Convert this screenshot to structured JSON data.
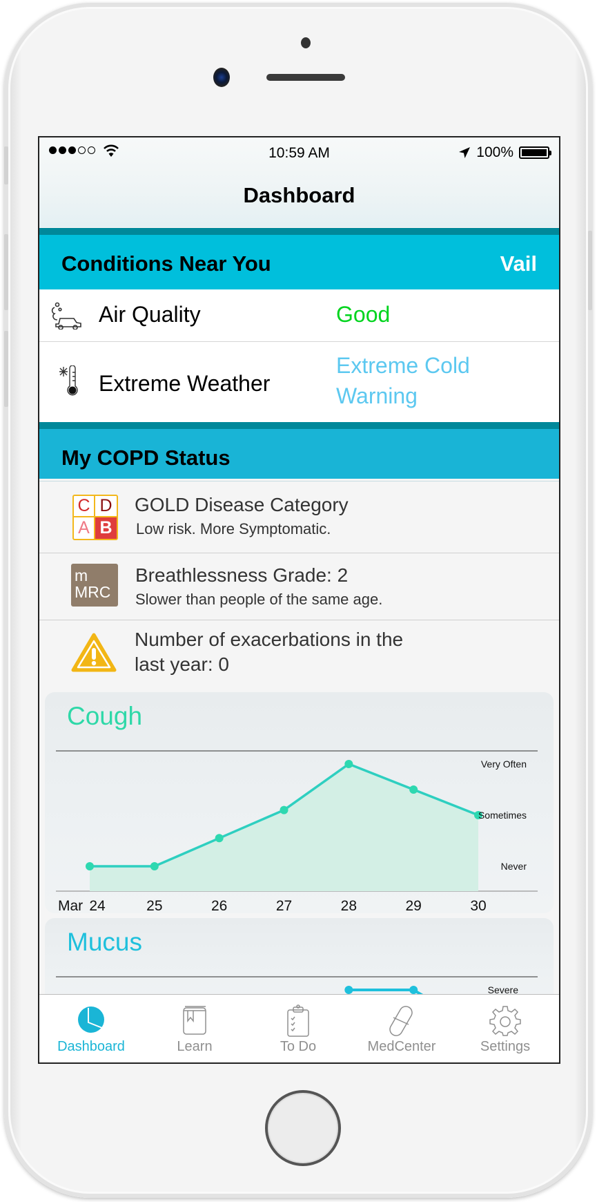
{
  "status_bar": {
    "signal_filled": 3,
    "signal_total": 5,
    "time": "10:59 AM",
    "battery_percent": "100%",
    "icons": [
      "signal-dots-icon",
      "wifi-icon",
      "location-arrow-icon",
      "battery-icon"
    ]
  },
  "nav": {
    "title": "Dashboard"
  },
  "conditions": {
    "header": "Conditions Near You",
    "location": "Vail",
    "rows": [
      {
        "icon": "air-pollution-car-icon",
        "label": "Air Quality",
        "value": "Good",
        "value_color": "#00d41e"
      },
      {
        "icon": "cold-thermometer-icon",
        "label": "Extreme Weather",
        "value_line1": "Extreme Cold",
        "value_line2": "Warning",
        "value_color": "#5cc8f0"
      }
    ]
  },
  "copd": {
    "header": "My COPD Status",
    "items": [
      {
        "icon": "gold-category-grid-icon",
        "grid": [
          "C",
          "D",
          "A",
          "B"
        ],
        "selected": "B",
        "title": "GOLD Disease Category",
        "subtitle": "Low risk. More Symptomatic."
      },
      {
        "icon": "mmrc-icon",
        "badge_line1": "m",
        "badge_line2": "MRC",
        "title": "Breathlessness Grade: 2",
        "subtitle": "Slower than people of the same age."
      },
      {
        "icon": "warning-triangle-icon",
        "title_line1": "Number of exacerbations in the",
        "title_line2": "last year: 0"
      }
    ]
  },
  "chart_data": [
    {
      "type": "area",
      "title": "Cough",
      "title_color": "#2ed8a8",
      "line_color": "#2ecfc0",
      "fill_color": "#d3efe5",
      "x_month_label": "Mar",
      "categories": [
        "24",
        "25",
        "26",
        "27",
        "28",
        "29",
        "30"
      ],
      "values": [
        0,
        0,
        0.55,
        1.1,
        2,
        1.5,
        1
      ],
      "y_ticks": [
        {
          "value": 2,
          "label": "Very Often"
        },
        {
          "value": 1,
          "label": "Sometimes"
        },
        {
          "value": 0,
          "label": "Never"
        }
      ],
      "ylim": [
        0,
        2
      ],
      "xlabel": "",
      "ylabel": "",
      "grid": false
    },
    {
      "type": "area",
      "title": "Mucus",
      "title_color": "#1ec0dc",
      "line_color": "#1ec0dc",
      "partial": true,
      "y_ticks": [
        {
          "value": 2,
          "label": "Severe"
        }
      ],
      "visible_points": [
        {
          "x": "28",
          "value": 2
        },
        {
          "x": "29",
          "value": 2
        }
      ]
    }
  ],
  "tabbar": {
    "active_color": "#1ab5d6",
    "inactive_color": "#8f8f8f",
    "tabs": [
      {
        "label": "Dashboard",
        "icon": "pie-chart-icon",
        "active": true
      },
      {
        "label": "Learn",
        "icon": "book-icon",
        "active": false
      },
      {
        "label": "To Do",
        "icon": "clipboard-checklist-icon",
        "active": false
      },
      {
        "label": "MedCenter",
        "icon": "pill-icon",
        "active": false
      },
      {
        "label": "Settings",
        "icon": "gear-icon",
        "active": false
      }
    ]
  }
}
